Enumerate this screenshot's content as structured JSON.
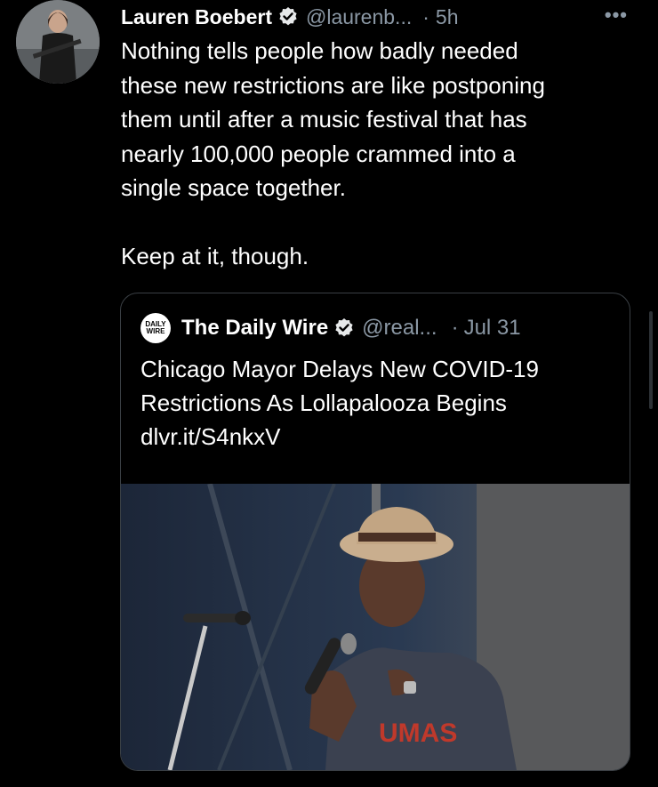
{
  "tweet": {
    "author_name": "Lauren Boebert",
    "author_handle": "@laurenb...",
    "separator": "·",
    "time": "5h",
    "more_label": "•••",
    "text": "Nothing tells people how badly needed\nthese new restrictions are like postponing\nthem until after a music festival that has\nnearly 100,000 people crammed into a\nsingle space together.\n\nKeep at it, though."
  },
  "quote": {
    "logo_line1": "DAILY",
    "logo_line2": "WIRE",
    "author_name": "The Daily Wire",
    "author_handle": "@real...",
    "separator": "·",
    "time": "Jul 31",
    "text": "Chicago Mayor Delays New COVID-19\nRestrictions As Lollapalooza Begins",
    "link": "dlvr.it/S4nkxV"
  },
  "colors": {
    "background": "#000000",
    "text": "#ffffff",
    "secondary": "#8b98a5",
    "border": "#3a3f44"
  }
}
